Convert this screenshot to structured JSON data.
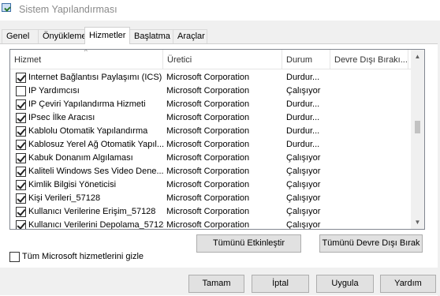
{
  "window": {
    "title": "Sistem Yapılandırması"
  },
  "tabs": [
    {
      "label": "Genel",
      "active": false
    },
    {
      "label": "Önyükleme",
      "active": false
    },
    {
      "label": "Hizmetler",
      "active": true
    },
    {
      "label": "Başlatma",
      "active": false
    },
    {
      "label": "Araçlar",
      "active": false
    }
  ],
  "services": {
    "columns": {
      "name": "Hizmet",
      "vendor": "Üretici",
      "status": "Durum",
      "disabled_date": "Devre Dışı Bırakı..."
    },
    "rows": [
      {
        "checked": true,
        "name": "Internet Bağlantısı Paylaşımı (ICS)",
        "vendor": "Microsoft Corporation",
        "status": "Durdur..."
      },
      {
        "checked": false,
        "name": "IP Yardımcısı",
        "vendor": "Microsoft Corporation",
        "status": "Çalışıyor"
      },
      {
        "checked": true,
        "name": "IP Çeviri Yapılandırma Hizmeti",
        "vendor": "Microsoft Corporation",
        "status": "Durdur..."
      },
      {
        "checked": true,
        "name": "IPsec İlke Aracısı",
        "vendor": "Microsoft Corporation",
        "status": "Durdur..."
      },
      {
        "checked": true,
        "name": "Kablolu Otomatik Yapılandırma",
        "vendor": "Microsoft Corporation",
        "status": "Durdur..."
      },
      {
        "checked": true,
        "name": "Kablosuz Yerel Ağ Otomatik Yapıl...",
        "vendor": "Microsoft Corporation",
        "status": "Durdur..."
      },
      {
        "checked": true,
        "name": "Kabuk Donanım Algılaması",
        "vendor": "Microsoft Corporation",
        "status": "Çalışıyor"
      },
      {
        "checked": true,
        "name": "Kaliteli Windows Ses Video Dene...",
        "vendor": "Microsoft Corporation",
        "status": "Çalışıyor"
      },
      {
        "checked": true,
        "name": "Kimlik Bilgisi Yöneticisi",
        "vendor": "Microsoft Corporation",
        "status": "Çalışıyor"
      },
      {
        "checked": true,
        "name": "Kişi Verileri_57128",
        "vendor": "Microsoft Corporation",
        "status": "Çalışıyor"
      },
      {
        "checked": true,
        "name": "Kullanıcı Verilerine Erişim_57128",
        "vendor": "Microsoft Corporation",
        "status": "Çalışıyor"
      },
      {
        "checked": true,
        "name": "Kullanıcı Verilerini Depolama_57128",
        "vendor": "Microsoft Corporation",
        "status": "Çalışıyor"
      }
    ]
  },
  "buttons": {
    "enable_all": "Tümünü Etkinleştir",
    "disable_all": "Tümünü Devre Dışı Bırak",
    "ok": "Tamam",
    "cancel": "İptal",
    "apply": "Uygula",
    "help": "Yardım"
  },
  "hide_microsoft": {
    "label": "Tüm Microsoft hizmetlerini gizle",
    "checked": false
  }
}
